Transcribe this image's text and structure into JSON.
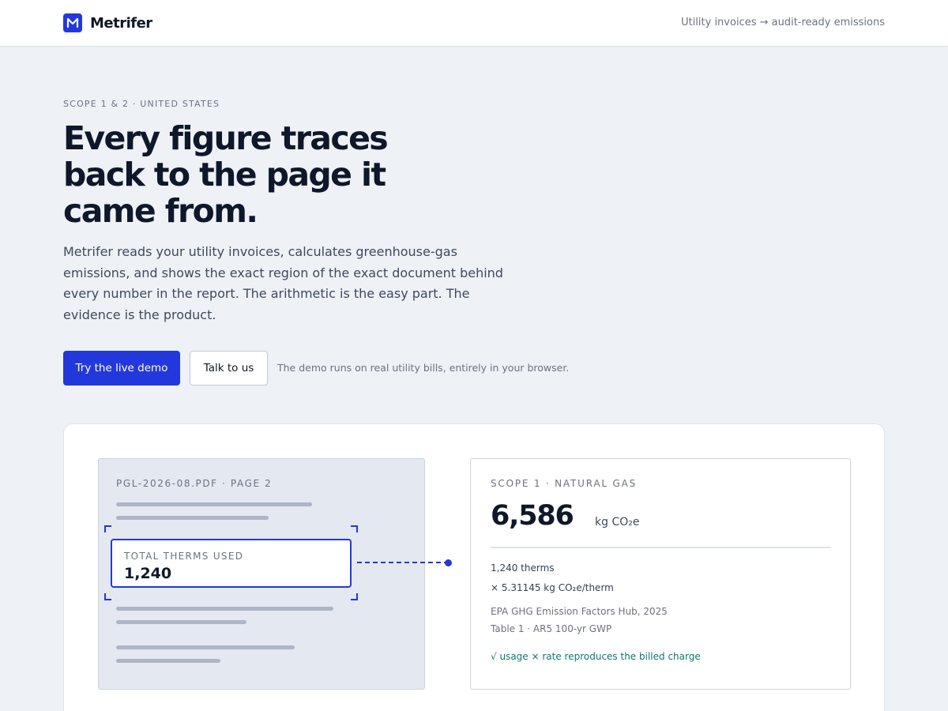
{
  "header": {
    "brand": "Metrifer",
    "tagline": "Utility invoices → audit-ready emissions",
    "logo_icon": "m-logo-icon",
    "accent_color": "#2338dc"
  },
  "hero": {
    "eyebrow": "SCOPE 1 & 2 · UNITED STATES",
    "headline": "Every figure traces back to the page it came from.",
    "lede": "Metrifer reads your utility invoices, calculates greenhouse-gas emissions, and shows the exact region of the exact document behind every number in the report. The arithmetic is the easy part. The evidence is the product.",
    "primary_cta": "Try the live demo",
    "secondary_cta": "Talk to us",
    "cta_note": "The demo runs on real utility bills, entirely in your browser."
  },
  "demo": {
    "document": {
      "title": "PGL-2026-08.PDF · PAGE 2",
      "field_label": "TOTAL THERMS USED",
      "field_value": "1,240"
    },
    "result": {
      "title": "SCOPE 1 · NATURAL GAS",
      "value": "6,586",
      "unit": "kg CO₂e",
      "usage": "1,240 therms",
      "factor": "× 5.31145 kg CO₂e/therm",
      "source_line1": "EPA GHG Emission Factors Hub, 2025",
      "source_line2": "Table 1 · AR5 100-yr GWP",
      "check": "√ usage × rate reproduces the billed charge",
      "check_color": "#0f766e"
    }
  }
}
